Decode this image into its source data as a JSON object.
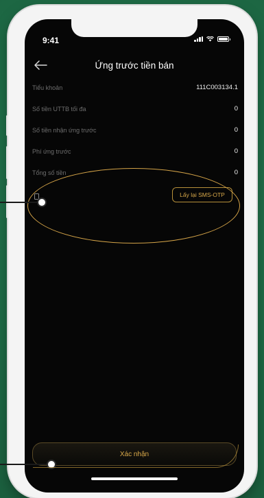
{
  "status_bar": {
    "time": "9:41"
  },
  "header": {
    "title": "Ứng trước tiền bán"
  },
  "rows": [
    {
      "label": "Tiểu khoản",
      "value": "111C003134.1"
    },
    {
      "label": "Số tiền UTTB tối đa",
      "value": "0"
    },
    {
      "label": "Số tiền nhận ứng trước",
      "value": "0"
    },
    {
      "label": "Phí ứng trước",
      "value": "0"
    },
    {
      "label": "Tổng số tiền",
      "value": "0"
    }
  ],
  "otp": {
    "resend_label": "Lấy lại SMS-OTP"
  },
  "footer": {
    "confirm_label": "Xác nhận"
  },
  "colors": {
    "background_green": "#1f6b46",
    "accent_gold": "#d9a94a",
    "screen_black": "#060606"
  },
  "icons": [
    "back-arrow-icon",
    "signal-icon",
    "wifi-icon",
    "battery-icon",
    "otp-lock-icon"
  ]
}
